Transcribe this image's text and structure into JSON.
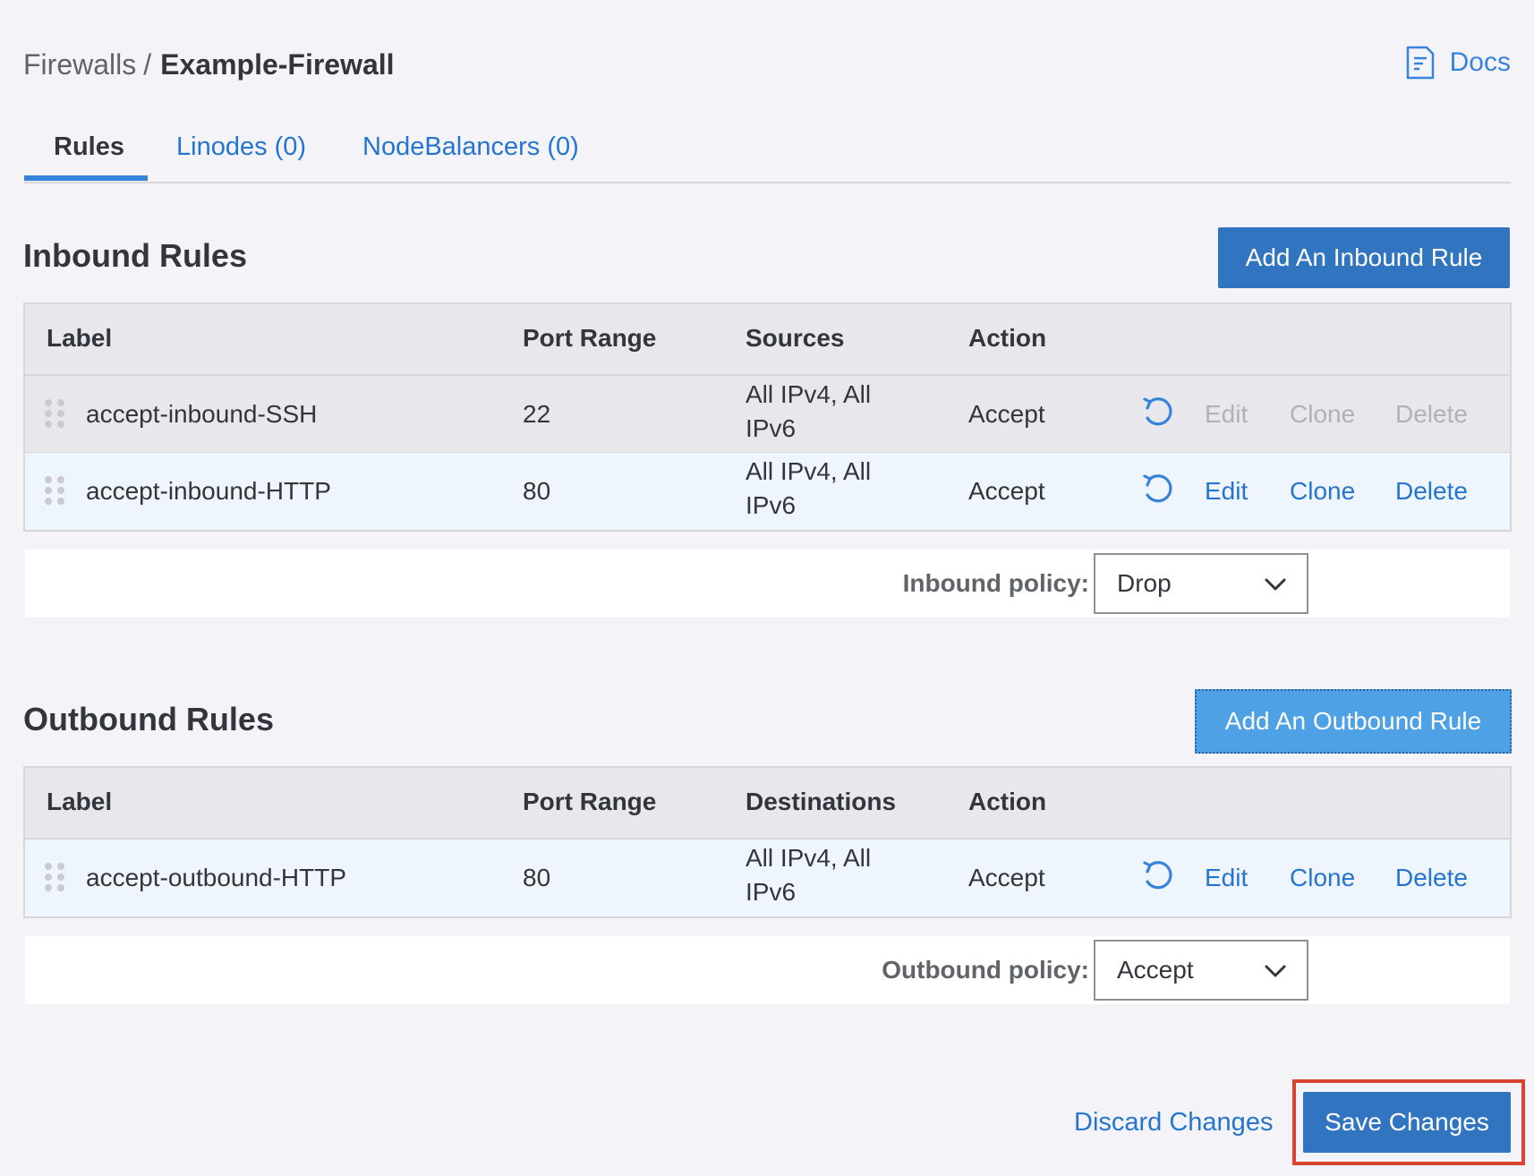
{
  "breadcrumb": {
    "parent": "Firewalls",
    "separator": "/",
    "current": "Example-Firewall"
  },
  "docs": {
    "label": "Docs",
    "icon": "docs-icon"
  },
  "tabs": [
    {
      "label": "Rules",
      "active": true
    },
    {
      "label": "Linodes (0)",
      "active": false
    },
    {
      "label": "NodeBalancers (0)",
      "active": false
    }
  ],
  "inbound": {
    "title": "Inbound Rules",
    "add_button": "Add An Inbound Rule",
    "columns": {
      "label": "Label",
      "port_range": "Port Range",
      "sources": "Sources",
      "action": "Action"
    },
    "rows": [
      {
        "label": "accept-inbound-SSH",
        "port_range": "22",
        "sources": "All IPv4, All IPv6",
        "action": "Accept",
        "edit": "Edit",
        "clone": "Clone",
        "delete": "Delete",
        "disabled": true
      },
      {
        "label": "accept-inbound-HTTP",
        "port_range": "80",
        "sources": "All IPv4, All IPv6",
        "action": "Accept",
        "edit": "Edit",
        "clone": "Clone",
        "delete": "Delete",
        "disabled": false
      }
    ],
    "policy_label": "Inbound policy:",
    "policy_value": "Drop"
  },
  "outbound": {
    "title": "Outbound Rules",
    "add_button": "Add An Outbound Rule",
    "columns": {
      "label": "Label",
      "port_range": "Port Range",
      "destinations": "Destinations",
      "action": "Action"
    },
    "rows": [
      {
        "label": "accept-outbound-HTTP",
        "port_range": "80",
        "destinations": "All IPv4, All IPv6",
        "action": "Accept",
        "edit": "Edit",
        "clone": "Clone",
        "delete": "Delete",
        "disabled": false
      }
    ],
    "policy_label": "Outbound policy:",
    "policy_value": "Accept"
  },
  "footer": {
    "discard": "Discard Changes",
    "save": "Save Changes"
  },
  "colors": {
    "accent": "#3683dc",
    "link": "#2575d0",
    "primary_button": "#3174c0",
    "focused_button": "#4ea1e4",
    "highlight_border": "#d8442f",
    "disabled_text": "#b0b2b6"
  }
}
